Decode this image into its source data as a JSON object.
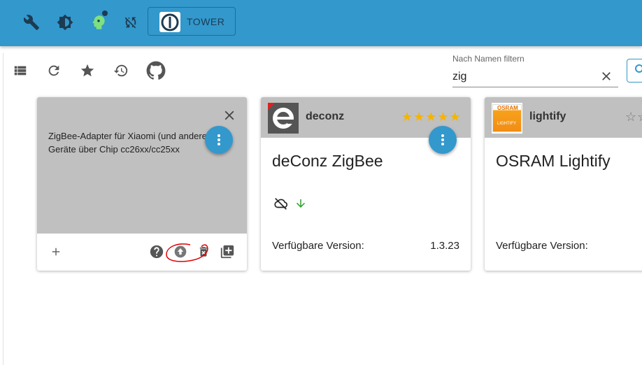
{
  "header": {
    "tower_label": "TOWER",
    "icons": [
      "wrench-icon",
      "brightness-icon",
      "head-icon",
      "sync-disabled-icon"
    ]
  },
  "toolbar": {
    "icons": [
      "list-icon",
      "refresh-icon",
      "star-icon",
      "history-icon",
      "github-icon"
    ]
  },
  "filter": {
    "label": "Nach Namen filtern",
    "value": "zig",
    "placeholder": ""
  },
  "cards": [
    {
      "description": "ZigBee-Adapter für Xiaomi (und andere) Geräte über Chip cc26xx/cc25xx"
    },
    {
      "short_name": "deconz",
      "title": "deConz ZigBee",
      "rating": 5,
      "version_label": "Verfügbare Version:",
      "version": "1.3.23"
    },
    {
      "short_name": "lightify",
      "title": "OSRAM Lightify",
      "rating": 0,
      "version_label": "Verfügbare Version:",
      "logo_text_top": "OSRAM",
      "logo_text_bottom": "LIGHTIFY"
    }
  ],
  "colors": {
    "header": "#3398cc",
    "card_head": "#c0c0c0",
    "fab": "#3398cc",
    "star": "#f5b400",
    "annotation": "#e00000",
    "update_arrow": "#2e9e2e"
  }
}
